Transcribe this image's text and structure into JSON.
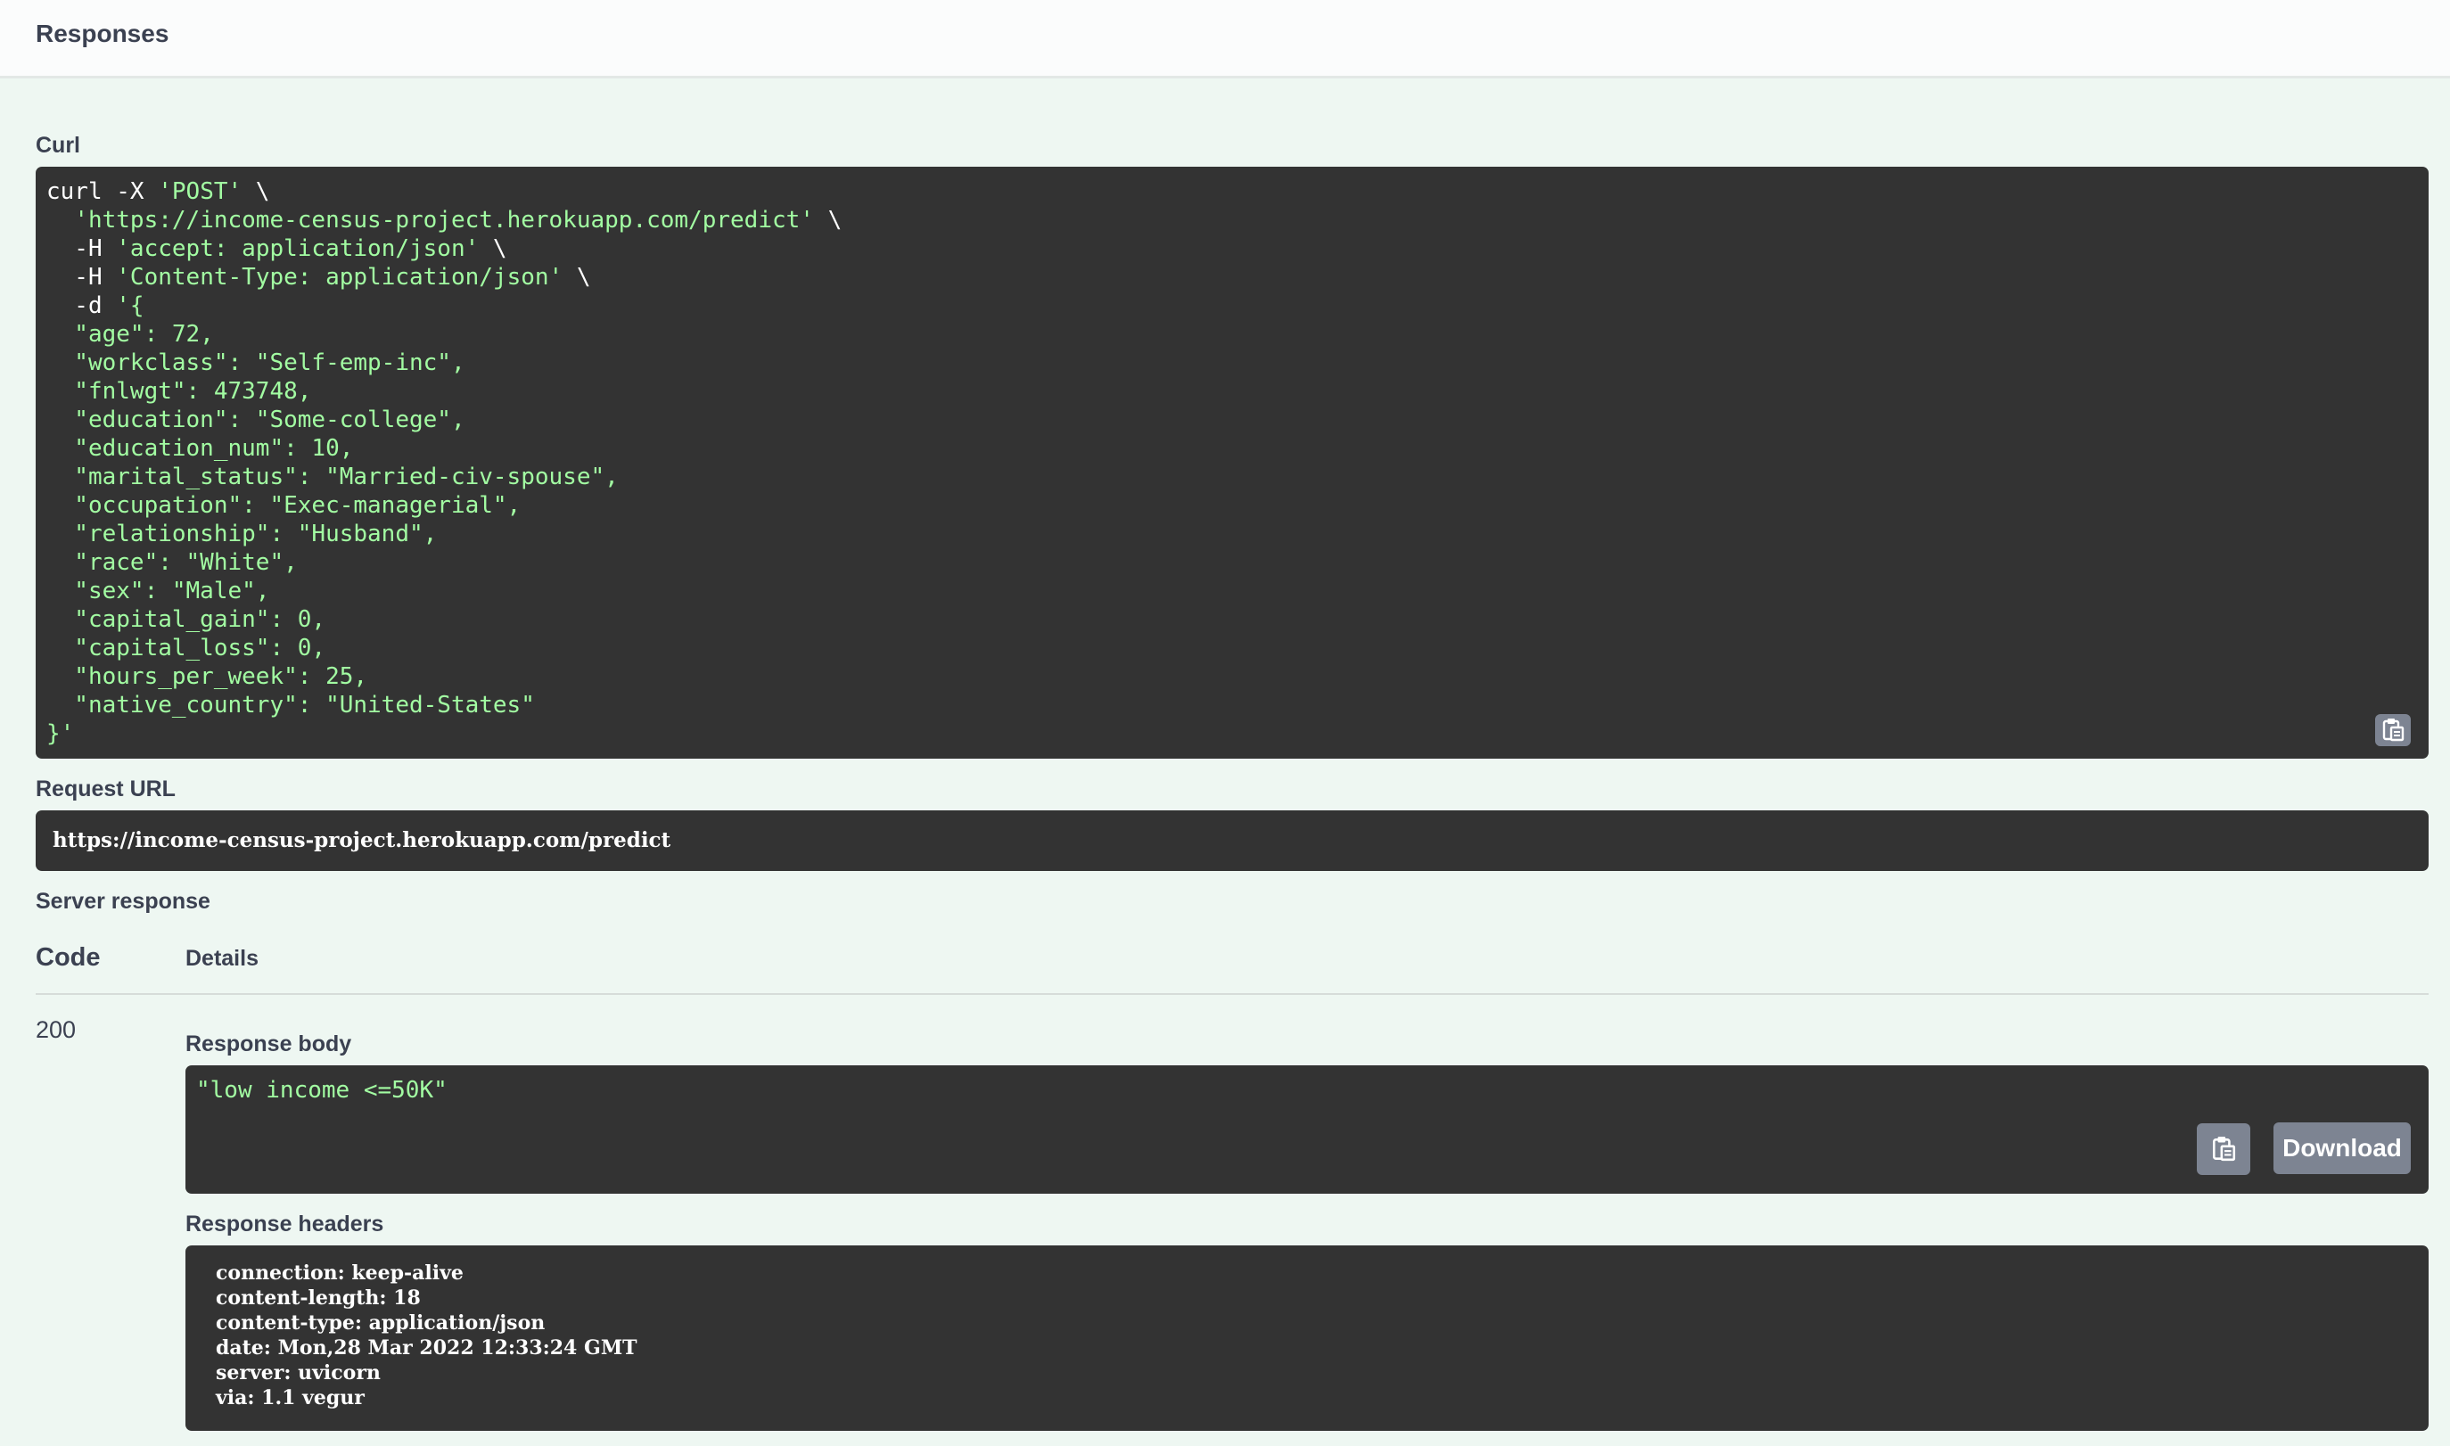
{
  "header": {
    "title": "Responses"
  },
  "curl": {
    "label": "Curl",
    "lines": [
      {
        "plain": "curl -X ",
        "str": "'POST'",
        "tail": " \\"
      },
      {
        "plain": "  ",
        "str": "'https://income-census-project.herokuapp.com/predict'",
        "tail": " \\"
      },
      {
        "plain": "  -H ",
        "str": "'accept: application/json'",
        "tail": " \\"
      },
      {
        "plain": "  -H ",
        "str": "'Content-Type: application/json'",
        "tail": " \\"
      },
      {
        "plain": "  -d ",
        "str": "'{",
        "tail": ""
      },
      {
        "plain": "",
        "str": "  \"age\": 72,",
        "tail": ""
      },
      {
        "plain": "",
        "str": "  \"workclass\": \"Self-emp-inc\",",
        "tail": ""
      },
      {
        "plain": "",
        "str": "  \"fnlwgt\": 473748,",
        "tail": ""
      },
      {
        "plain": "",
        "str": "  \"education\": \"Some-college\",",
        "tail": ""
      },
      {
        "plain": "",
        "str": "  \"education_num\": 10,",
        "tail": ""
      },
      {
        "plain": "",
        "str": "  \"marital_status\": \"Married-civ-spouse\",",
        "tail": ""
      },
      {
        "plain": "",
        "str": "  \"occupation\": \"Exec-managerial\",",
        "tail": ""
      },
      {
        "plain": "",
        "str": "  \"relationship\": \"Husband\",",
        "tail": ""
      },
      {
        "plain": "",
        "str": "  \"race\": \"White\",",
        "tail": ""
      },
      {
        "plain": "",
        "str": "  \"sex\": \"Male\",",
        "tail": ""
      },
      {
        "plain": "",
        "str": "  \"capital_gain\": 0,",
        "tail": ""
      },
      {
        "plain": "",
        "str": "  \"capital_loss\": 0,",
        "tail": ""
      },
      {
        "plain": "",
        "str": "  \"hours_per_week\": 25,",
        "tail": ""
      },
      {
        "plain": "",
        "str": "  \"native_country\": \"United-States\"",
        "tail": ""
      },
      {
        "plain": "",
        "str": "}'",
        "tail": ""
      }
    ],
    "copy_icon": "clipboard-icon"
  },
  "request_url": {
    "label": "Request URL",
    "value": "https://income-census-project.herokuapp.com/predict"
  },
  "server_response": {
    "label": "Server response",
    "code_header": "Code",
    "details_header": "Details",
    "code": "200",
    "response_body_label": "Response body",
    "response_body": "\"low income <=50K\"",
    "download_label": "Download",
    "response_headers_label": "Response headers",
    "headers": [
      "connection: keep-alive",
      "content-length: 18",
      "content-type: application/json",
      "date: Mon,28 Mar 2022 12:33:24 GMT",
      "server: uvicorn",
      "via: 1.1 vegur"
    ]
  },
  "colors": {
    "background": "#eef7f2",
    "code_background": "#333333",
    "string_color": "#a2fca2",
    "button_gray": "#7d8492",
    "text": "#3b4151"
  }
}
